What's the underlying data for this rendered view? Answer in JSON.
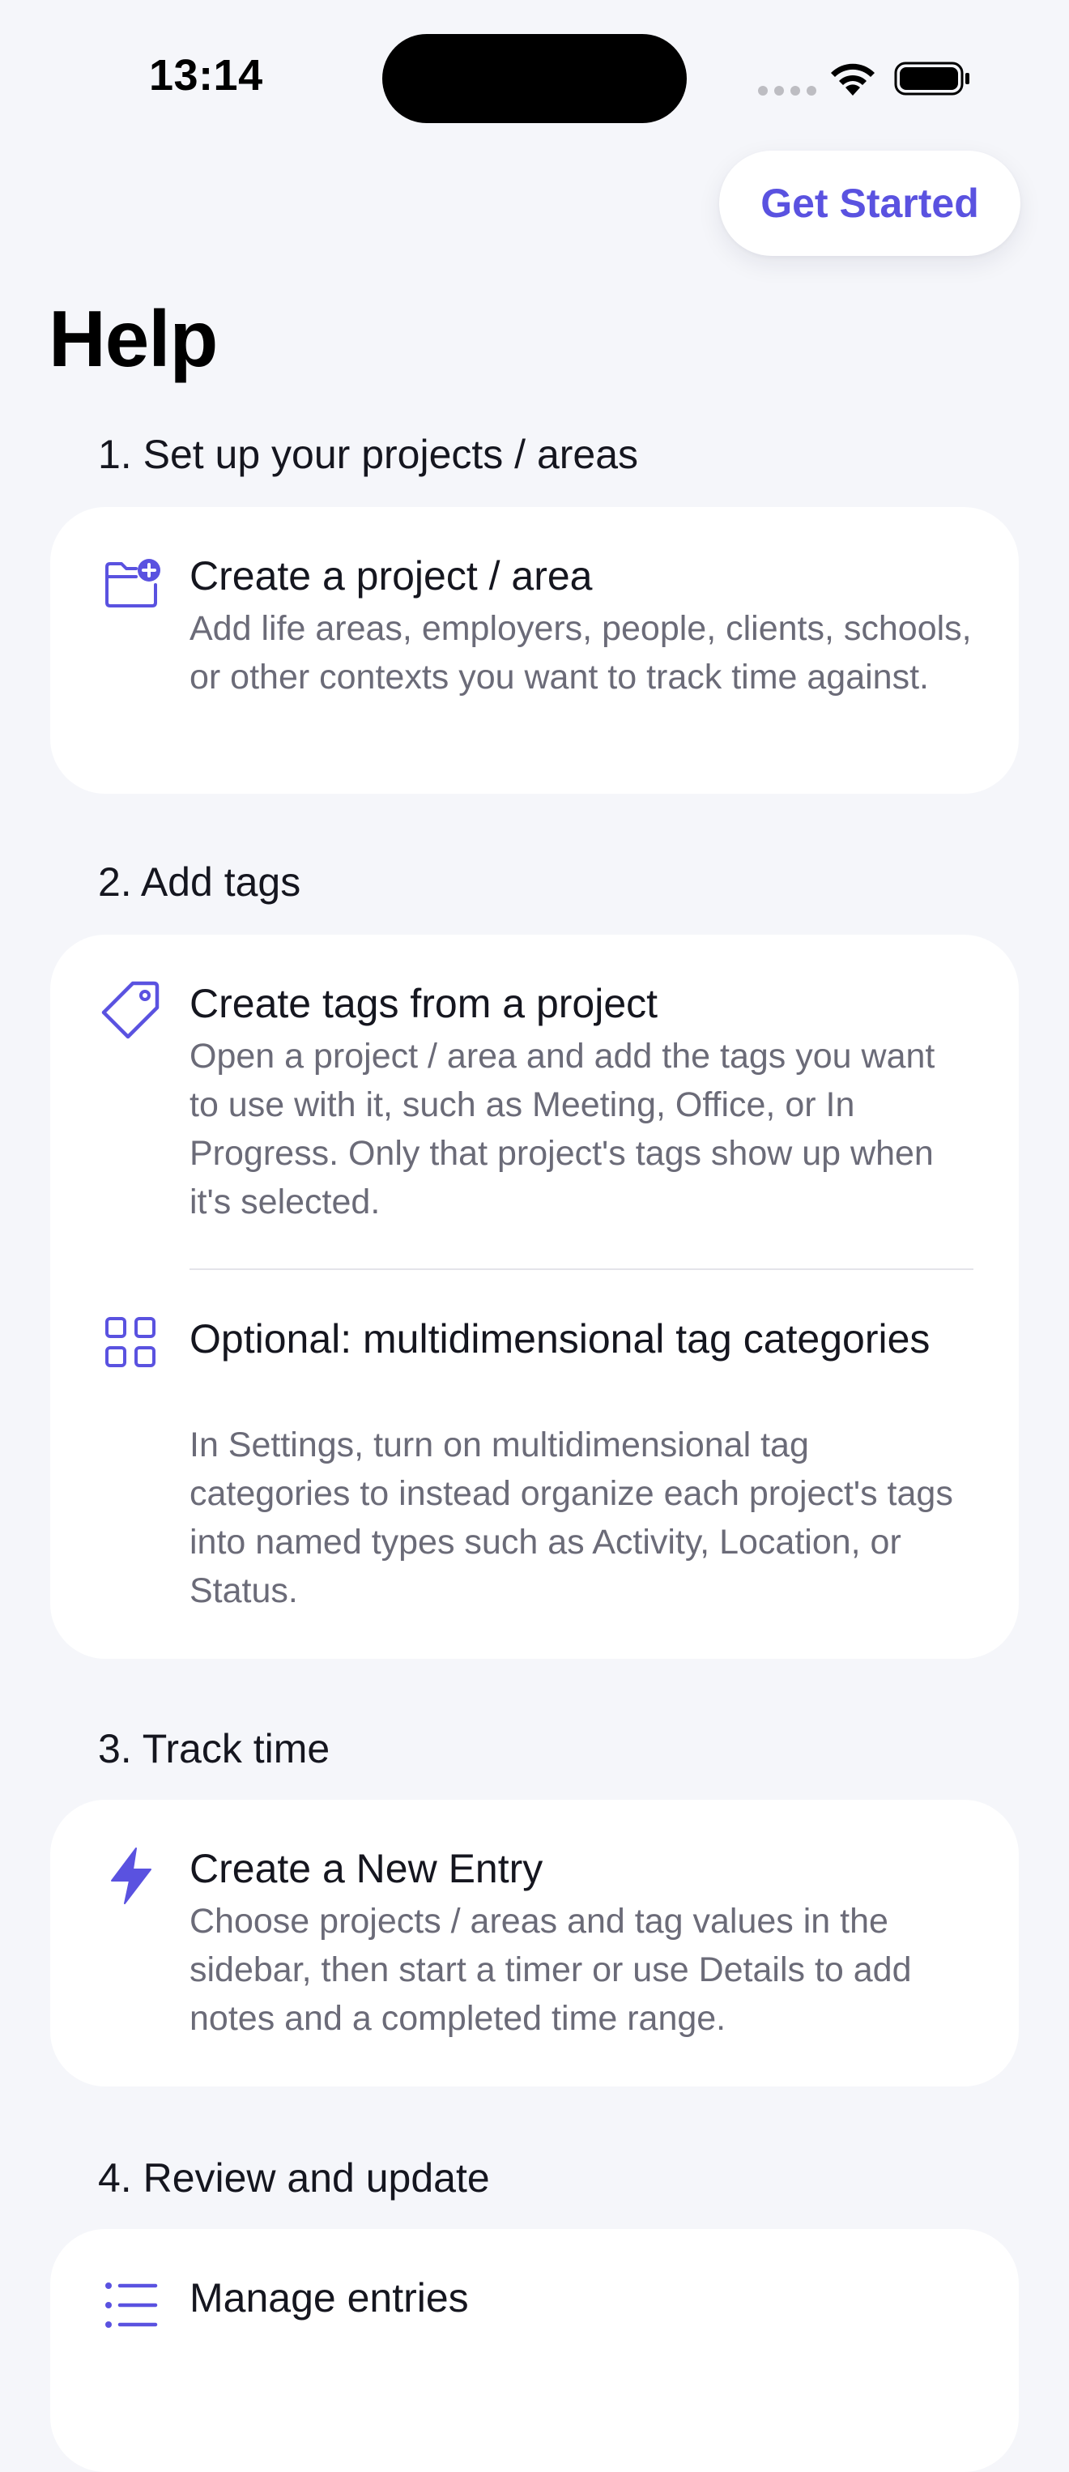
{
  "status_bar": {
    "time": "13:14"
  },
  "header": {
    "get_started_label": "Get Started",
    "title": "Help"
  },
  "colors": {
    "accent": "#5A52E0",
    "background": "#F5F6FA",
    "card": "#FFFFFF",
    "secondary_text": "#6B6B78"
  },
  "sections": [
    {
      "heading": "1. Set up your projects / areas",
      "items": [
        {
          "icon": "folder-plus-icon",
          "title": "Create a project / area",
          "description": "Add life areas, employers, people, clients, schools, or other contexts you want to track time against."
        }
      ]
    },
    {
      "heading": "2. Add tags",
      "items": [
        {
          "icon": "tag-icon",
          "title": "Create tags from a project",
          "description": "Open a project / area and add the tags you want to use with it, such as Meeting, Office, or In Progress. Only that project's tags show up when it's selected."
        },
        {
          "icon": "grid-icon",
          "title": "Optional: multidimensional tag categories",
          "description": "In Settings, turn on multidimensional tag categories to instead organize each project's tags into named types such as Activity, Location, or Status."
        }
      ]
    },
    {
      "heading": "3. Track time",
      "items": [
        {
          "icon": "bolt-icon",
          "title": "Create a New Entry",
          "description": "Choose projects / areas and tag values in the sidebar, then start a timer or use Details to add notes and a completed time range."
        }
      ]
    },
    {
      "heading": "4. Review and update",
      "items": [
        {
          "icon": "list-icon",
          "title": "Manage entries",
          "description": ""
        }
      ]
    }
  ]
}
